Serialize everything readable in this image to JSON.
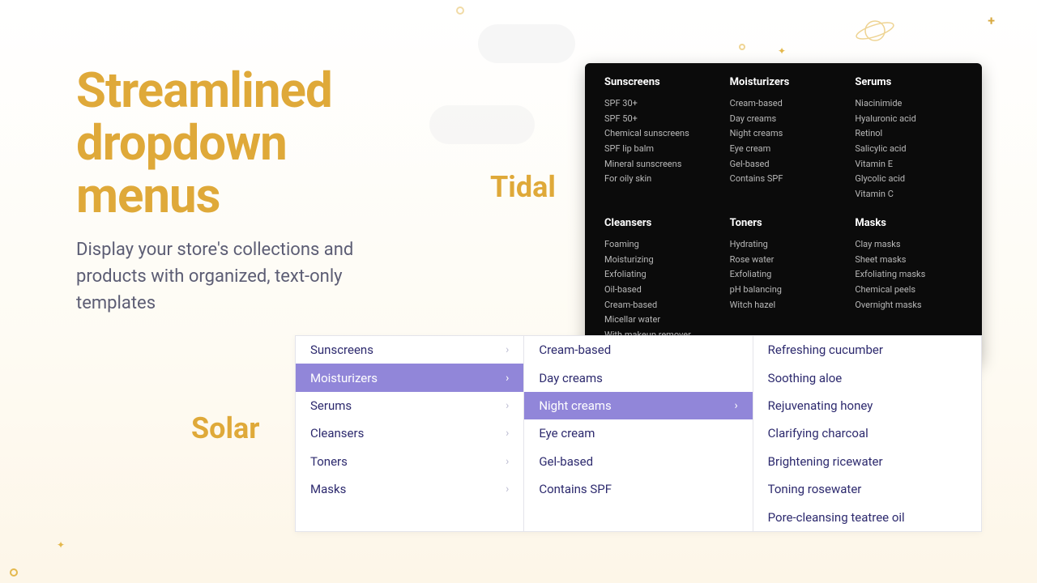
{
  "hero": {
    "title": "Streamlined dropdown menus",
    "subtitle": "Display your store's collections and products with organized, text-only templates"
  },
  "labels": {
    "tidal": "Tidal",
    "solar": "Solar"
  },
  "tidal": {
    "columns": [
      {
        "heading": "Sunscreens",
        "items": [
          "SPF 30+",
          "SPF 50+",
          "Chemical sunscreens",
          "SPF lip balm",
          "Mineral sunscreens",
          "For oily skin"
        ]
      },
      {
        "heading": "Moisturizers",
        "items": [
          "Cream-based",
          "Day creams",
          "Night creams",
          "Eye cream",
          "Gel-based",
          "Contains SPF"
        ]
      },
      {
        "heading": "Serums",
        "items": [
          "Niacinimide",
          "Hyaluronic acid",
          "Retinol",
          "Salicylic acid",
          "Vitamin E",
          "Glycolic acid",
          "Vitamin C"
        ]
      },
      {
        "heading": "Cleansers",
        "items": [
          "Foaming",
          "Moisturizing",
          "Exfoliating",
          "Oil-based",
          "Cream-based",
          "Micellar water",
          "With makeup remover"
        ]
      },
      {
        "heading": "Toners",
        "items": [
          "Hydrating",
          "Rose water",
          "Exfoliating",
          "pH balancing",
          "Witch hazel"
        ]
      },
      {
        "heading": "Masks",
        "items": [
          "Clay masks",
          "Sheet masks",
          "Exfoliating masks",
          "Chemical peels",
          "Overnight masks"
        ]
      }
    ]
  },
  "solar": {
    "col1": [
      {
        "label": "Sunscreens",
        "selected": false
      },
      {
        "label": "Moisturizers",
        "selected": true
      },
      {
        "label": "Serums",
        "selected": false
      },
      {
        "label": "Cleansers",
        "selected": false
      },
      {
        "label": "Toners",
        "selected": false
      },
      {
        "label": "Masks",
        "selected": false
      }
    ],
    "col2": [
      {
        "label": "Cream-based",
        "selected": false
      },
      {
        "label": "Day creams",
        "selected": false
      },
      {
        "label": "Night creams",
        "selected": true
      },
      {
        "label": "Eye cream",
        "selected": false
      },
      {
        "label": "Gel-based",
        "selected": false
      },
      {
        "label": "Contains SPF",
        "selected": false
      }
    ],
    "col3": [
      "Refreshing cucumber",
      "Soothing aloe",
      "Rejuvenating honey",
      "Clarifying charcoal",
      "Brightening ricewater",
      "Toning rosewater",
      "Pore-cleansing teatree oil"
    ]
  },
  "colors": {
    "accent": "#dfa939",
    "select": "#9186d9",
    "link": "#2d2a6e"
  }
}
